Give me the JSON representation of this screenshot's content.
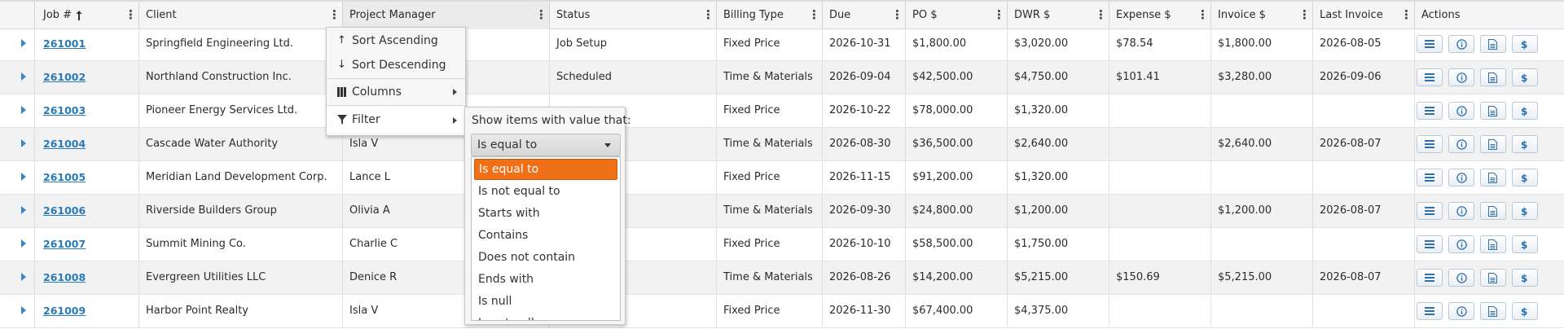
{
  "columns": [
    {
      "label": "",
      "key": "expand"
    },
    {
      "label": "Job #",
      "key": "job",
      "sort_icon": "arrow-up-icon"
    },
    {
      "label": "Client",
      "key": "client"
    },
    {
      "label": "Project Manager",
      "key": "pm"
    },
    {
      "label": "Status",
      "key": "status"
    },
    {
      "label": "Billing Type",
      "key": "billing"
    },
    {
      "label": "Due",
      "key": "due"
    },
    {
      "label": "PO $",
      "key": "po"
    },
    {
      "label": "DWR $",
      "key": "dwr"
    },
    {
      "label": "Expense $",
      "key": "expense"
    },
    {
      "label": "Invoice $",
      "key": "invoice"
    },
    {
      "label": "Last Invoice",
      "key": "last_invoice"
    },
    {
      "label": "Actions",
      "key": "actions"
    }
  ],
  "rows": [
    {
      "job": "261001",
      "client": "Springfield Engineering Ltd.",
      "pm": "",
      "status": "Job Setup",
      "billing": "Fixed Price",
      "due": "2026-10-31",
      "po": "$1,800.00",
      "dwr": "$3,020.00",
      "expense": "$78.54",
      "invoice": "$1,800.00",
      "last_invoice": "2026-08-05"
    },
    {
      "job": "261002",
      "client": "Northland Construction Inc.",
      "pm": "",
      "status": "Scheduled",
      "billing": "Time & Materials",
      "due": "2026-09-04",
      "po": "$42,500.00",
      "dwr": "$4,750.00",
      "expense": "$101.41",
      "invoice": "$3,280.00",
      "last_invoice": "2026-09-06"
    },
    {
      "job": "261003",
      "client": "Pioneer Energy Services Ltd.",
      "pm": "",
      "status": "",
      "billing": "Fixed Price",
      "due": "2026-10-22",
      "po": "$78,000.00",
      "dwr": "$1,320.00",
      "expense": "",
      "invoice": "",
      "last_invoice": ""
    },
    {
      "job": "261004",
      "client": "Cascade Water Authority",
      "pm": "Isla V",
      "status": "",
      "billing": "Time & Materials",
      "due": "2026-08-30",
      "po": "$36,500.00",
      "dwr": "$2,640.00",
      "expense": "",
      "invoice": "$2,640.00",
      "last_invoice": "2026-08-07"
    },
    {
      "job": "261005",
      "client": "Meridian Land Development Corp.",
      "pm": "Lance L",
      "status": "",
      "billing": "Fixed Price",
      "due": "2026-11-15",
      "po": "$91,200.00",
      "dwr": "$1,320.00",
      "expense": "",
      "invoice": "",
      "last_invoice": ""
    },
    {
      "job": "261006",
      "client": "Riverside Builders Group",
      "pm": "Olivia A",
      "status": "",
      "billing": "Time & Materials",
      "due": "2026-09-30",
      "po": "$24,800.00",
      "dwr": "$1,200.00",
      "expense": "",
      "invoice": "$1,200.00",
      "last_invoice": "2026-08-07"
    },
    {
      "job": "261007",
      "client": "Summit Mining Co.",
      "pm": "Charlie C",
      "status": "",
      "billing": "Fixed Price",
      "due": "2026-10-10",
      "po": "$58,500.00",
      "dwr": "$1,750.00",
      "expense": "",
      "invoice": "",
      "last_invoice": ""
    },
    {
      "job": "261008",
      "client": "Evergreen Utilities LLC",
      "pm": "Denice R",
      "status": "",
      "billing": "Time & Materials",
      "due": "2026-08-26",
      "po": "$14,200.00",
      "dwr": "$5,215.00",
      "expense": "$150.69",
      "invoice": "$5,215.00",
      "last_invoice": "2026-08-07"
    },
    {
      "job": "261009",
      "client": "Harbor Point Realty",
      "pm": "Isla V",
      "status": "",
      "billing": "Fixed Price",
      "due": "2026-11-30",
      "po": "$67,400.00",
      "dwr": "$4,375.00",
      "expense": "",
      "invoice": "",
      "last_invoice": ""
    }
  ],
  "actions": [
    {
      "name": "details-button",
      "icon": "list-icon"
    },
    {
      "name": "info-button",
      "icon": "info-icon"
    },
    {
      "name": "document-button",
      "icon": "document-icon"
    },
    {
      "name": "billing-button",
      "icon": "dollar-icon"
    }
  ],
  "column_menu": {
    "sort_ascending": "Sort Ascending",
    "sort_descending": "Sort Descending",
    "columns": "Columns",
    "filter": "Filter"
  },
  "filter": {
    "label": "Show items with value that:",
    "selected": "Is equal to",
    "options": [
      "Is equal to",
      "Is not equal to",
      "Starts with",
      "Contains",
      "Does not contain",
      "Ends with",
      "Is null",
      "Is not null"
    ]
  },
  "colors": {
    "accent": "#f07018",
    "link": "#2a7ab8",
    "expander": "#3a86c6"
  }
}
